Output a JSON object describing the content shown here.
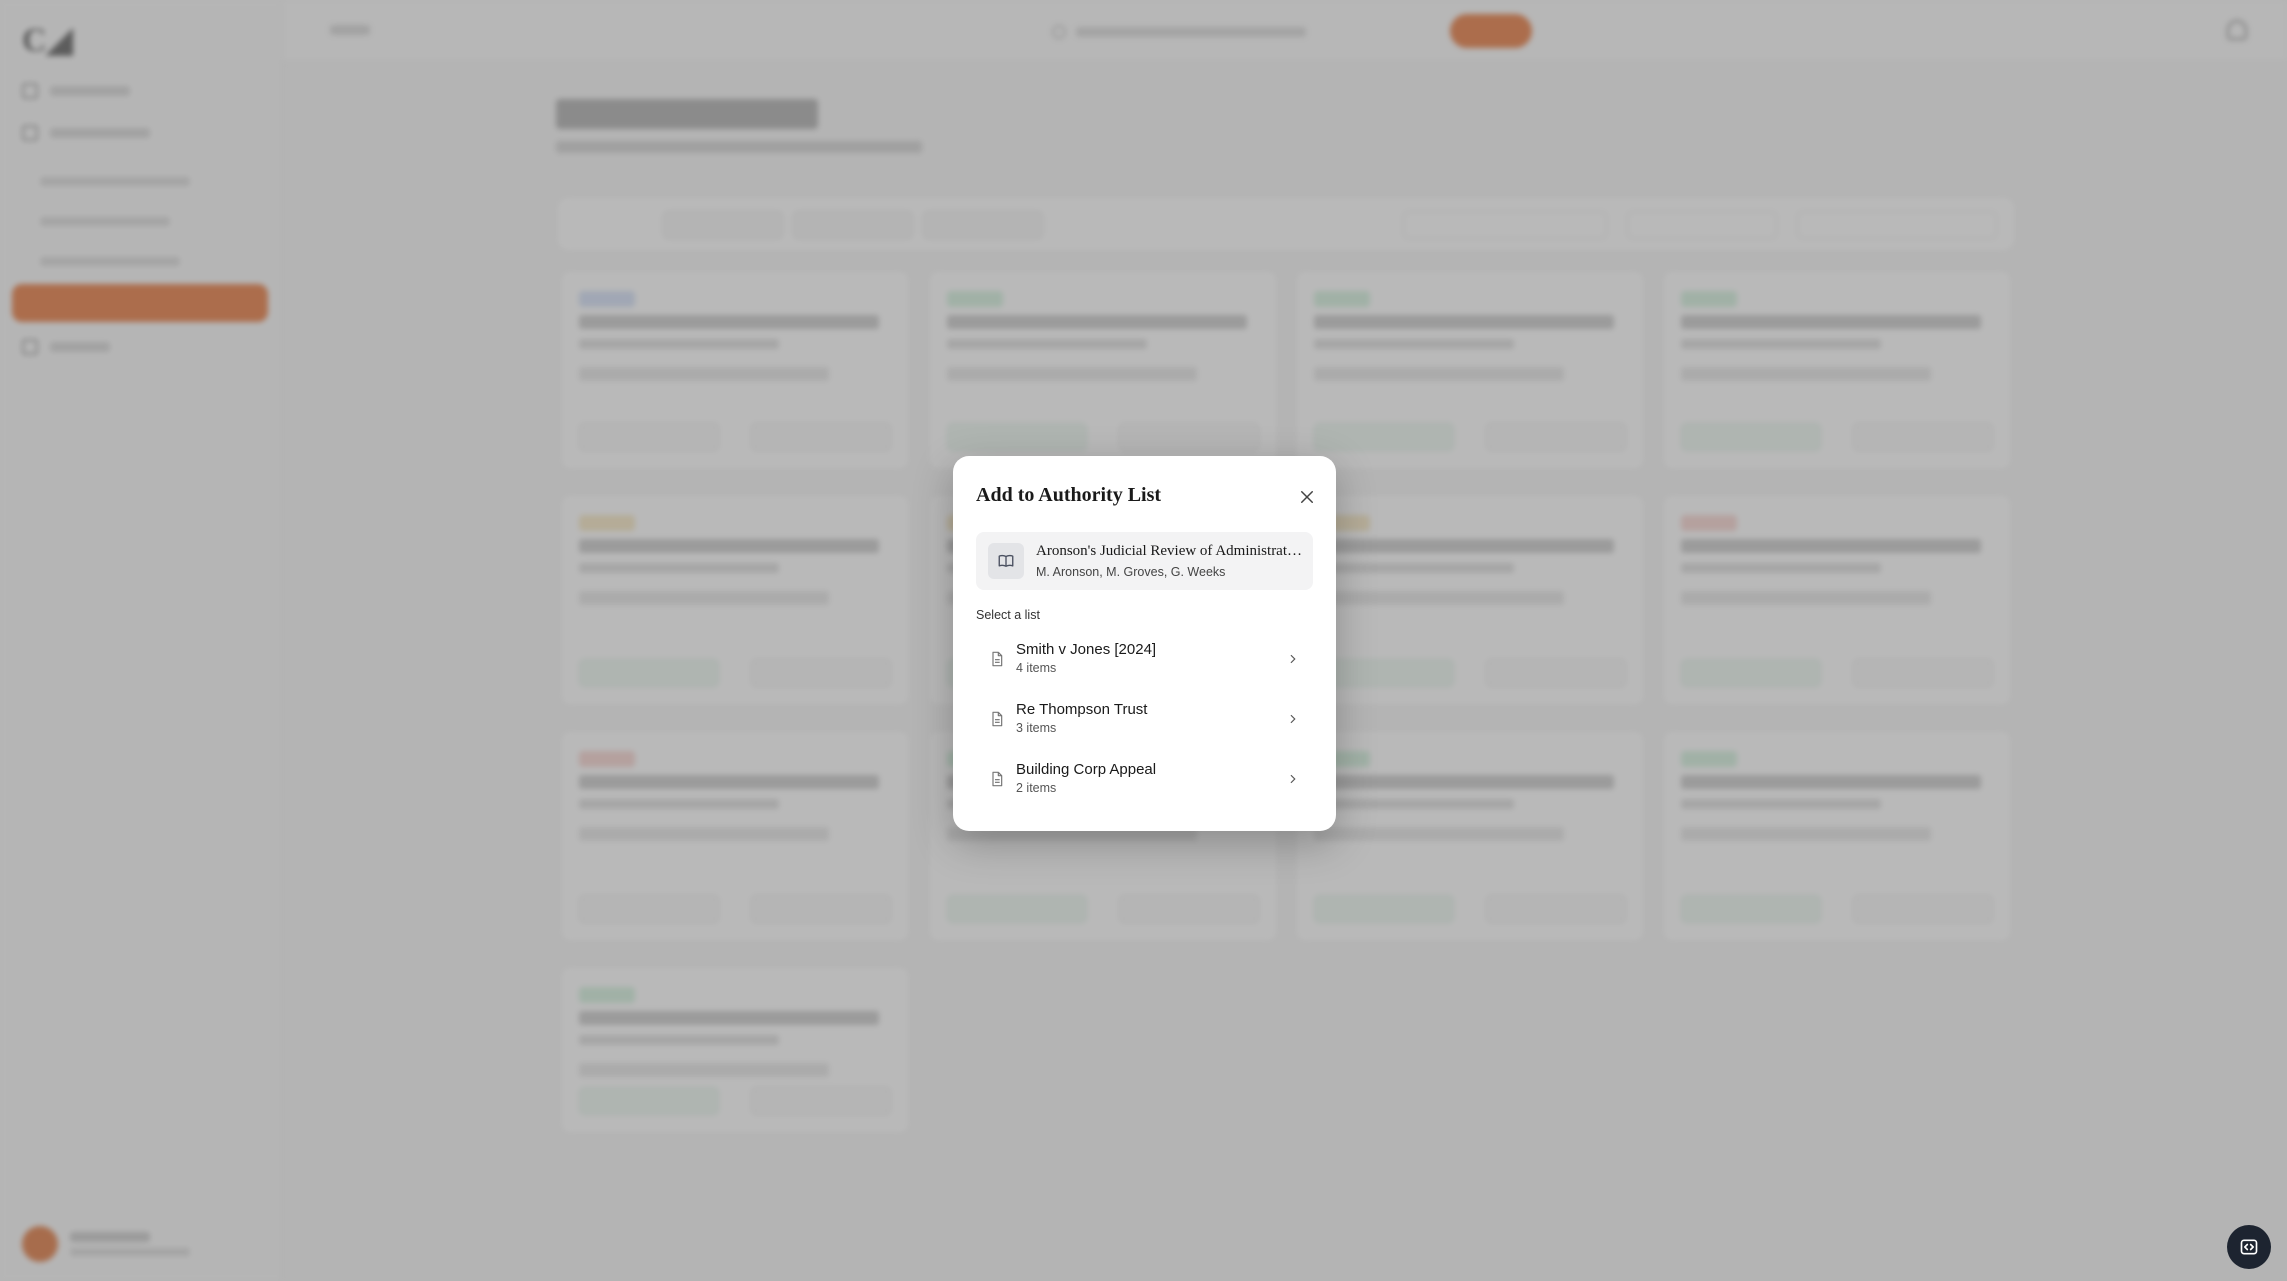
{
  "modal": {
    "title": "Add to Authority List",
    "book": {
      "title": "Aronson's Judicial Review of Administrative Action and Government Liability",
      "authors": "M. Aronson, M. Groves, G. Weeks",
      "icon": "book-open-icon"
    },
    "select_label": "Select a list",
    "lists": [
      {
        "name": "Smith v Jones [2024]",
        "count": "4 items"
      },
      {
        "name": "Re Thompson Trust",
        "count": "3 items"
      },
      {
        "name": "Building Corp Appeal",
        "count": "2 items"
      }
    ]
  },
  "colors": {
    "accent": "#e2580f",
    "overlay": "rgba(128,128,128,0.55)",
    "dock": "#1d2430"
  }
}
